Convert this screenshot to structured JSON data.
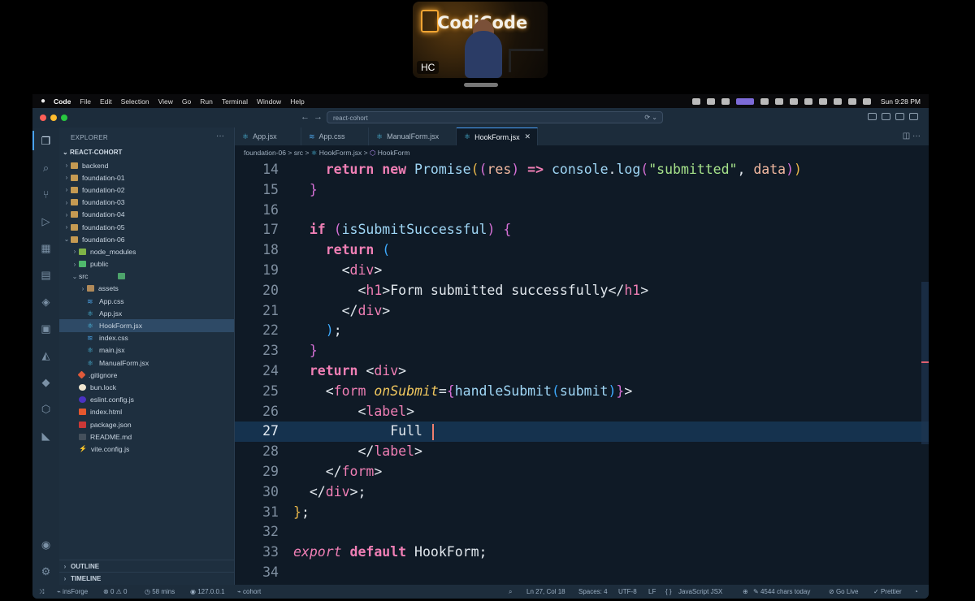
{
  "webcam": {
    "logo_text": "CodiCode",
    "initials": "HC"
  },
  "menubar": {
    "app_name": "Code",
    "items": [
      "File",
      "Edit",
      "Selection",
      "View",
      "Go",
      "Run",
      "Terminal",
      "Window",
      "Help"
    ],
    "clock": "Sun 9:28 PM"
  },
  "window": {
    "search_text": "react-cohort"
  },
  "explorer": {
    "header": "EXPLORER",
    "more": "···",
    "root": "REACT-COHORT",
    "tree": [
      {
        "label": "backend",
        "type": "folder",
        "depth": 0,
        "open": false
      },
      {
        "label": "foundation-01",
        "type": "folder",
        "depth": 0,
        "open": false
      },
      {
        "label": "foundation-02",
        "type": "folder",
        "depth": 0,
        "open": false
      },
      {
        "label": "foundation-03",
        "type": "folder",
        "depth": 0,
        "open": false
      },
      {
        "label": "foundation-04",
        "type": "folder",
        "depth": 0,
        "open": false
      },
      {
        "label": "foundation-05",
        "type": "folder",
        "depth": 0,
        "open": false
      },
      {
        "label": "foundation-06",
        "type": "folder",
        "depth": 0,
        "open": true
      },
      {
        "label": "node_modules",
        "type": "folder-nm",
        "depth": 1,
        "open": false
      },
      {
        "label": "public",
        "type": "folder-pub",
        "depth": 1,
        "open": false
      },
      {
        "label": "src",
        "type": "folder-src",
        "depth": 1,
        "open": true
      },
      {
        "label": "assets",
        "type": "folder-ast",
        "depth": 2,
        "open": false
      },
      {
        "label": "App.css",
        "type": "css",
        "depth": 2
      },
      {
        "label": "App.jsx",
        "type": "react",
        "depth": 2
      },
      {
        "label": "HookForm.jsx",
        "type": "react",
        "depth": 2,
        "selected": true
      },
      {
        "label": "index.css",
        "type": "css",
        "depth": 2
      },
      {
        "label": "main.jsx",
        "type": "react",
        "depth": 2
      },
      {
        "label": "ManualForm.jsx",
        "type": "react",
        "depth": 2
      },
      {
        "label": ".gitignore",
        "type": "git",
        "depth": 1
      },
      {
        "label": "bun.lock",
        "type": "bun",
        "depth": 1
      },
      {
        "label": "eslint.config.js",
        "type": "eslint",
        "depth": 1
      },
      {
        "label": "index.html",
        "type": "html",
        "depth": 1
      },
      {
        "label": "package.json",
        "type": "npm",
        "depth": 1
      },
      {
        "label": "README.md",
        "type": "md",
        "depth": 1
      },
      {
        "label": "vite.config.js",
        "type": "vite",
        "depth": 1
      }
    ],
    "outline": "OUTLINE",
    "timeline": "TIMELINE"
  },
  "tabs": [
    {
      "label": "App.jsx",
      "icon": "react"
    },
    {
      "label": "App.css",
      "icon": "css"
    },
    {
      "label": "ManualForm.jsx",
      "icon": "react"
    },
    {
      "label": "HookForm.jsx",
      "icon": "react",
      "active": true
    }
  ],
  "breadcrumb": {
    "folder": "foundation-06",
    "src": "src",
    "file": "HookForm.jsx",
    "symbol": "HookForm",
    "sep": ">"
  },
  "code": {
    "current_line": 27,
    "lines": [
      {
        "n": "14",
        "t": [
          [
            "    ",
            ""
          ],
          [
            "return",
            "kw"
          ],
          [
            " ",
            ""
          ],
          [
            "new",
            "kw"
          ],
          [
            " ",
            ""
          ],
          [
            "Promise",
            "fn"
          ],
          [
            "(",
            "p1"
          ],
          [
            "(",
            "p2"
          ],
          [
            "res",
            "var"
          ],
          [
            ")",
            "p2"
          ],
          [
            " ",
            ""
          ],
          [
            "=>",
            "kw"
          ],
          [
            " ",
            ""
          ],
          [
            "console",
            "fn"
          ],
          [
            ".",
            ""
          ],
          [
            "log",
            "fn"
          ],
          [
            "(",
            "p2"
          ],
          [
            "\"submitted\"",
            "str"
          ],
          [
            ", ",
            ""
          ],
          [
            "data",
            "var"
          ],
          [
            ")",
            "p2"
          ],
          [
            ")",
            "p1"
          ]
        ]
      },
      {
        "n": "15",
        "t": [
          [
            "  ",
            ""
          ],
          [
            "}",
            "p2"
          ]
        ]
      },
      {
        "n": "16",
        "t": []
      },
      {
        "n": "17",
        "t": [
          [
            "  ",
            ""
          ],
          [
            "if",
            "kw"
          ],
          [
            " ",
            ""
          ],
          [
            "(",
            "p2"
          ],
          [
            "isSubmitSuccessful",
            "fn"
          ],
          [
            ")",
            "p2"
          ],
          [
            " ",
            ""
          ],
          [
            "{",
            "p2"
          ]
        ]
      },
      {
        "n": "18",
        "t": [
          [
            "    ",
            ""
          ],
          [
            "return",
            "kw"
          ],
          [
            " ",
            ""
          ],
          [
            "(",
            "p3"
          ]
        ]
      },
      {
        "n": "19",
        "t": [
          [
            "      ",
            ""
          ],
          [
            "<",
            ""
          ],
          [
            "div",
            "tag"
          ],
          [
            ">",
            ""
          ]
        ]
      },
      {
        "n": "20",
        "t": [
          [
            "        ",
            ""
          ],
          [
            "<",
            ""
          ],
          [
            "h1",
            "tag"
          ],
          [
            ">Form submitted successfully</",
            ""
          ],
          [
            "h1",
            "tag"
          ],
          [
            ">",
            ""
          ]
        ]
      },
      {
        "n": "21",
        "t": [
          [
            "      ",
            ""
          ],
          [
            "</",
            ""
          ],
          [
            "div",
            "tag"
          ],
          [
            ">",
            ""
          ]
        ]
      },
      {
        "n": "22",
        "t": [
          [
            "    ",
            ""
          ],
          [
            ")",
            "p3"
          ],
          [
            ";",
            ""
          ]
        ]
      },
      {
        "n": "23",
        "t": [
          [
            "  ",
            ""
          ],
          [
            "}",
            "p2"
          ]
        ]
      },
      {
        "n": "24",
        "t": [
          [
            "  ",
            ""
          ],
          [
            "return",
            "kw"
          ],
          [
            " <",
            ""
          ],
          [
            "div",
            "tag"
          ],
          [
            ">",
            ""
          ]
        ]
      },
      {
        "n": "25",
        "t": [
          [
            "    <",
            ""
          ],
          [
            "form",
            "tag"
          ],
          [
            " ",
            ""
          ],
          [
            "onSubmit",
            "attr"
          ],
          [
            "=",
            ""
          ],
          [
            "{",
            "p2"
          ],
          [
            "handleSubmit",
            "fn"
          ],
          [
            "(",
            "p3"
          ],
          [
            "submit",
            "fn"
          ],
          [
            ")",
            "p3"
          ],
          [
            "}",
            "p2"
          ],
          [
            ">",
            ""
          ]
        ]
      },
      {
        "n": "26",
        "t": [
          [
            "        <",
            ""
          ],
          [
            "label",
            "tag"
          ],
          [
            ">",
            ""
          ]
        ]
      },
      {
        "n": "27",
        "t": [
          [
            "            Full ",
            ""
          ]
        ],
        "cursor": true
      },
      {
        "n": "28",
        "t": [
          [
            "        </",
            ""
          ],
          [
            "label",
            "tag"
          ],
          [
            ">",
            ""
          ]
        ]
      },
      {
        "n": "29",
        "t": [
          [
            "    </",
            ""
          ],
          [
            "form",
            "tag"
          ],
          [
            ">",
            ""
          ]
        ]
      },
      {
        "n": "30",
        "t": [
          [
            "  </",
            ""
          ],
          [
            "div",
            "tag"
          ],
          [
            ">;",
            ""
          ]
        ]
      },
      {
        "n": "31",
        "t": [
          [
            "}",
            "p1"
          ],
          [
            ";",
            ""
          ]
        ]
      },
      {
        "n": "32",
        "t": []
      },
      {
        "n": "33",
        "t": [
          [
            "export",
            "it"
          ],
          [
            " ",
            ""
          ],
          [
            "default",
            "kw"
          ],
          [
            " HookForm;",
            ""
          ]
        ]
      },
      {
        "n": "34",
        "t": []
      }
    ]
  },
  "status": {
    "remote": "insForge",
    "errors": "0",
    "warnings": "0",
    "time": "58 mins",
    "server": "127.0.0.1",
    "project": "cohort",
    "position": "Ln 27, Col 18",
    "spaces": "Spaces: 4",
    "encoding": "UTF-8",
    "eol": "LF",
    "language": "JavaScript JSX",
    "chars": "4544 chars today",
    "golive": "Go Live",
    "prettier": "Prettier"
  }
}
